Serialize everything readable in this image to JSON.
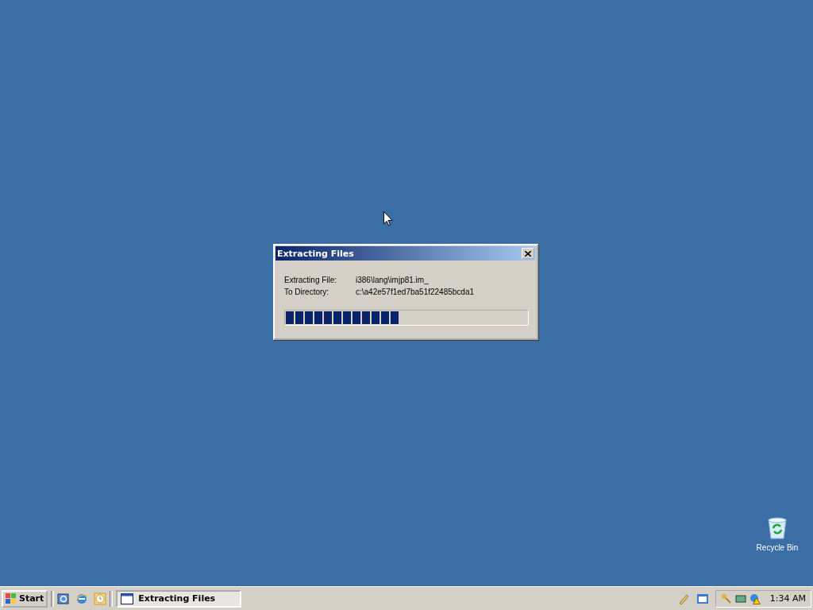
{
  "dialog": {
    "title": "Extracting Files",
    "fields": [
      {
        "label": "Extracting File:",
        "value": "i386\\lang\\imjp81.im_"
      },
      {
        "label": "To Directory:",
        "value": "c:\\a42e57f1ed7ba51f22485bcda1"
      }
    ],
    "progress": {
      "level": 0.47
    }
  },
  "desktop_icons": [
    {
      "label": "Recycle Bin"
    }
  ],
  "taskbar": {
    "start": "Start",
    "tasks": [
      {
        "label": "Extracting Files",
        "selected": true
      }
    ],
    "clock": "1:34 AM"
  }
}
